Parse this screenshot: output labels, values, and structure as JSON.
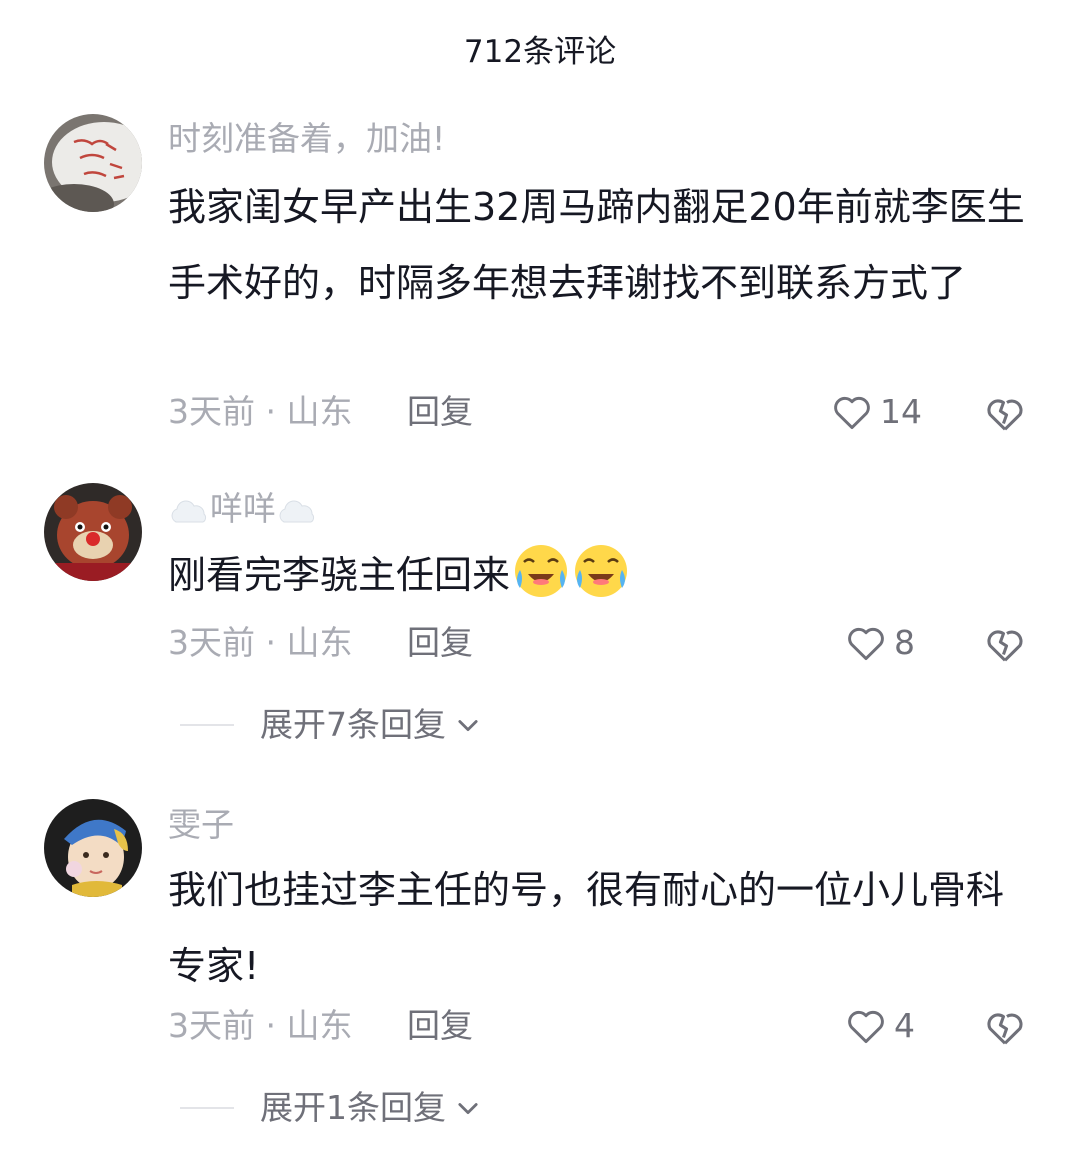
{
  "header": {
    "title": "712条评论"
  },
  "comments": [
    {
      "username": "时刻准备着，加油!",
      "text": "我家闺女早产出生32周马蹄内翻足20年前就李医生手术好的，时隔多年想去拜谢找不到联系方式了",
      "time": "3天前",
      "location": "山东",
      "reply_label": "回复",
      "likes": "14"
    },
    {
      "username": "咩咩",
      "text": "刚看完李骁主任回来",
      "time": "3天前",
      "location": "山东",
      "reply_label": "回复",
      "likes": "8",
      "expand_label": "展开7条回复"
    },
    {
      "username": "雯子",
      "text": "我们也挂过李主任的号，很有耐心的一位小儿骨科专家!",
      "time": "3天前",
      "location": "山东",
      "reply_label": "回复",
      "likes": "4",
      "expand_label": "展开1条回复"
    }
  ],
  "icons": {
    "like": "heart-outline-icon",
    "dislike": "broken-heart-icon",
    "expand": "chevron-down-icon",
    "emoji": "crying-laughing-emoji-icon",
    "decor": "cloud-icon"
  },
  "colors": {
    "text_primary": "#161823",
    "text_secondary": "#a9abb3",
    "text_action": "#6f7079"
  }
}
